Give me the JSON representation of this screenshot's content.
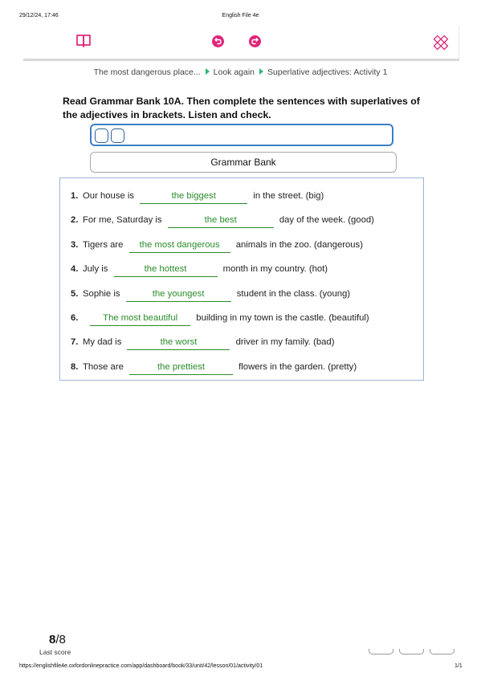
{
  "print_header": {
    "datetime": "29/12/24, 17:46",
    "title": "English File 4e"
  },
  "toolbar": {
    "book_icon": "book-icon",
    "undo_icon": "undo-icon",
    "redo_icon": "redo-icon",
    "tools_icon": "pencil-ruler-icon",
    "accent_color": "#e0267a"
  },
  "breadcrumb": [
    "The most dangerous place...",
    "Look again",
    "Superlative adjectives: Activity 1"
  ],
  "instruction": "Read Grammar Bank 10A. Then complete the sentences with superlatives of the adjectives in brackets. Listen and check.",
  "grammar_bank_button": "Grammar Bank",
  "items": [
    {
      "num": "1.",
      "before": "Our house is",
      "answer": "the biggest",
      "after": "in the street. (big)"
    },
    {
      "num": "2.",
      "before": "For me, Saturday is",
      "answer": "the best",
      "after": "day of the week. (good)"
    },
    {
      "num": "3.",
      "before": "Tigers are",
      "answer": "the most dangerous",
      "after": "animals in the zoo. (dangerous)"
    },
    {
      "num": "4.",
      "before": "July is",
      "answer": "the hottest",
      "after": "month in my country. (hot)"
    },
    {
      "num": "5.",
      "before": "Sophie is",
      "answer": "the youngest",
      "after": "student in the class. (young)"
    },
    {
      "num": "6.",
      "before": "",
      "answer": "The most beautiful",
      "after": "building in my town is the castle. (beautiful)"
    },
    {
      "num": "7.",
      "before": "My dad is",
      "answer": "the worst",
      "after": "driver in my family. (bad)"
    },
    {
      "num": "8.",
      "before": "Those are",
      "answer": "the prettiest",
      "after": "flowers in the garden. (pretty)"
    }
  ],
  "score": {
    "value": "8",
    "total": "/8",
    "label": "Last score"
  },
  "footer": {
    "url": "https://englishfile4e.oxfordonlinepractice.com/app/dashboard/book/33/unit/42/lesson/01/activity/01",
    "page": "1/1"
  }
}
